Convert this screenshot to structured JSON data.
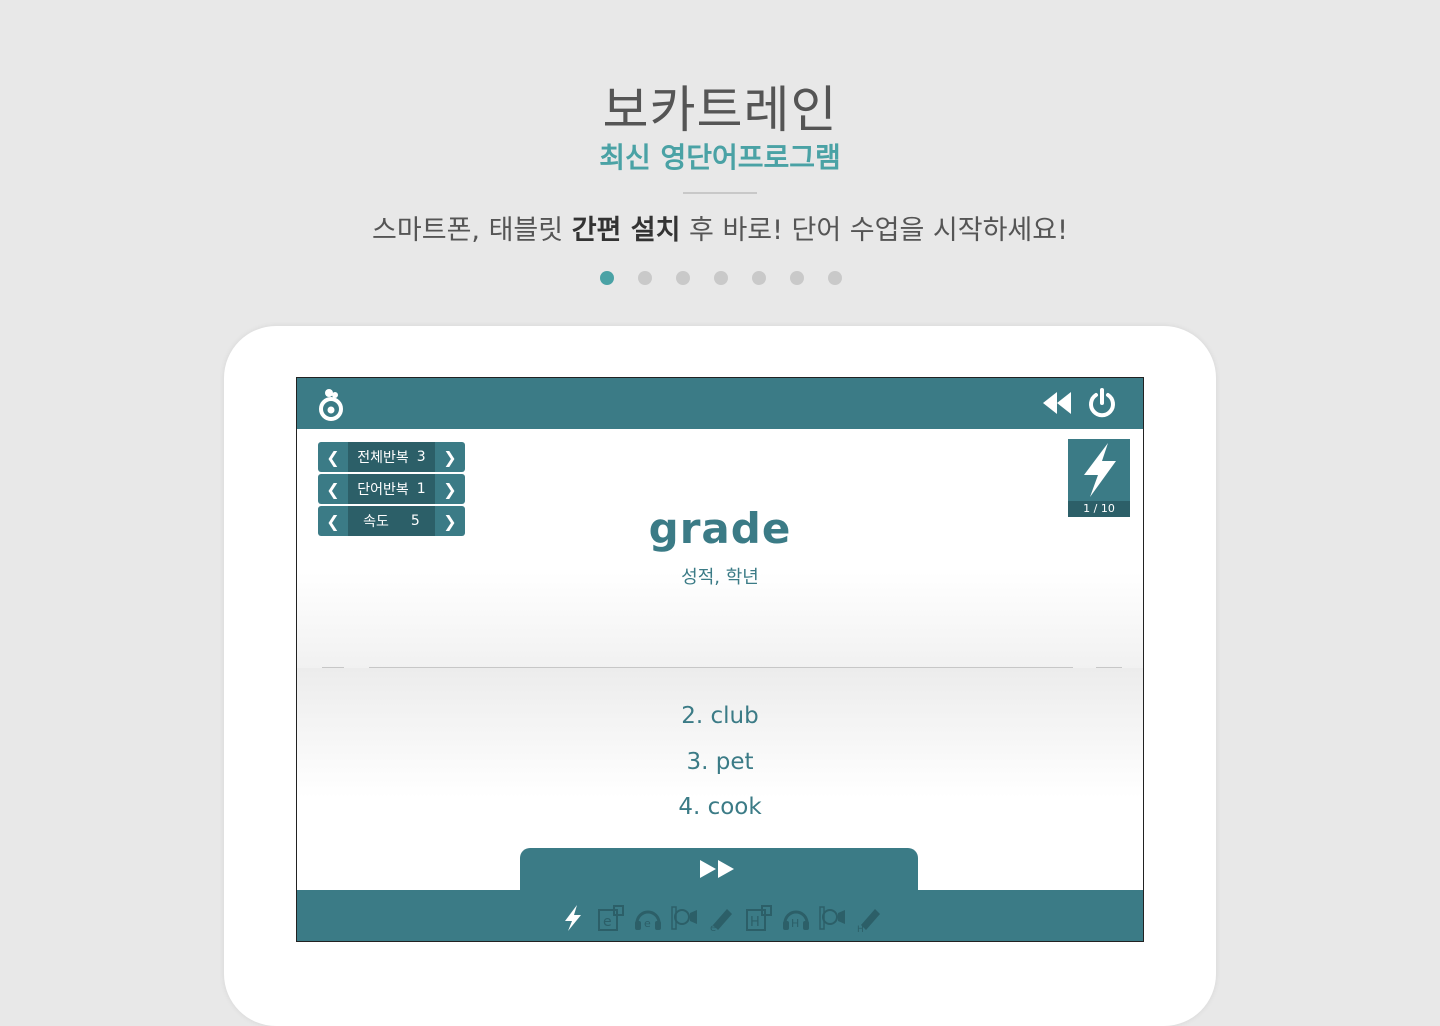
{
  "hero": {
    "title": "보카트레인",
    "subtitle": "최신 영단어프로그램",
    "desc_pre": "스마트폰, 태블릿 ",
    "desc_bold": "간편 설치",
    "desc_post": " 후 바로! 단어 수업을 시작하세요!",
    "page_count": 7,
    "active_page": 1
  },
  "app": {
    "colors": {
      "primary": "#3b7b86",
      "primary_dark": "#2c5f68",
      "accent": "#4aa2a5"
    },
    "controls": [
      {
        "label": "전체반복",
        "value": "3"
      },
      {
        "label": "단어반복",
        "value": "1"
      },
      {
        "label": "속도",
        "value": "5"
      }
    ],
    "counter": "1 / 10",
    "word": "grade",
    "meaning": "성적, 학년",
    "options": [
      "2. club",
      "3. pet",
      "4. cook"
    ],
    "mode_icons": [
      "bolt-icon",
      "e-book-icon",
      "e-listen-icon",
      "e-speak-icon",
      "e-write-icon",
      "h-book-icon",
      "h-listen-icon",
      "h-speak-icon",
      "h-write-icon"
    ]
  }
}
